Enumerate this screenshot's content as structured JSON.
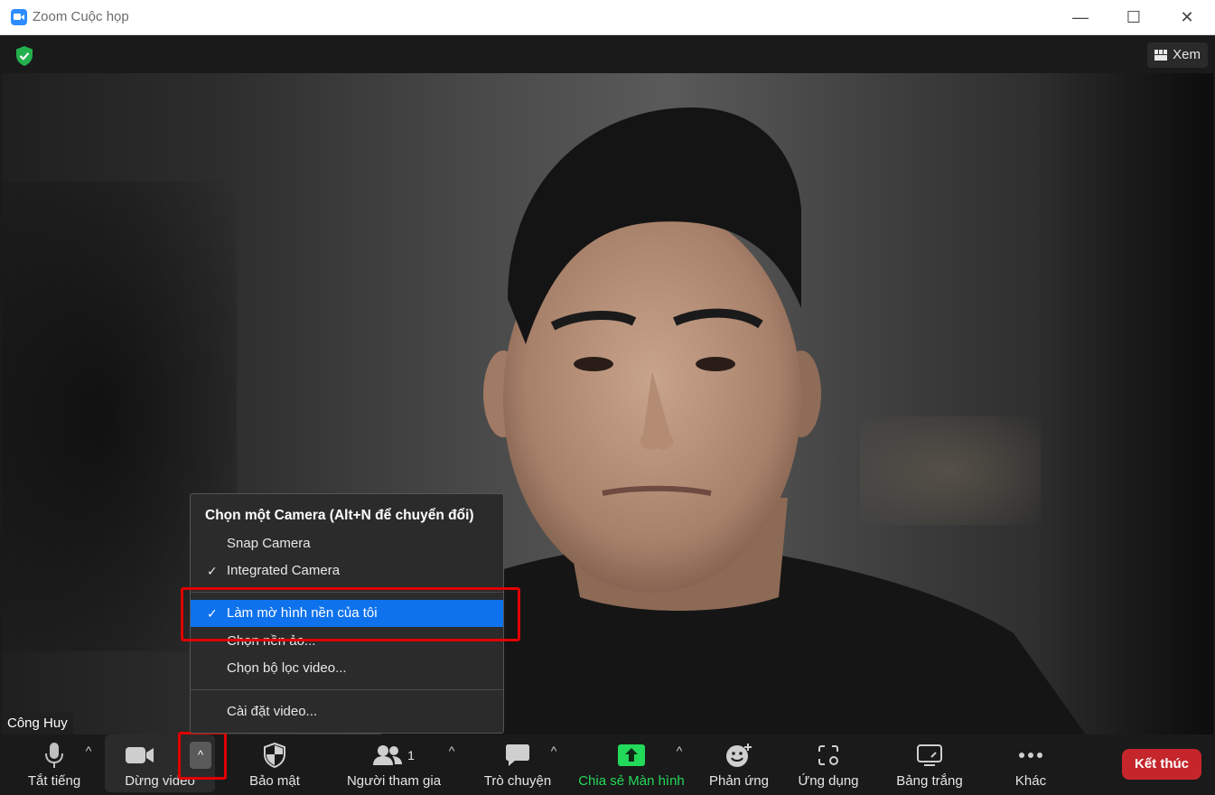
{
  "window": {
    "title": "Zoom Cuộc họp",
    "minimize": "—",
    "maximize": "☐",
    "close": "✕"
  },
  "top": {
    "view_label": "Xem"
  },
  "video": {
    "participant_name": "Công Huy"
  },
  "toolbar": {
    "mute_label": "Tắt tiếng",
    "video_label": "Dừng video",
    "security_label": "Bảo mật",
    "participants_label": "Người tham gia",
    "participants_count": "1",
    "chat_label": "Trò chuyện",
    "share_label": "Chia sẻ Màn hình",
    "reactions_label": "Phản ứng",
    "apps_label": "Ứng dụng",
    "whiteboard_label": "Bảng trắng",
    "more_label": "Khác",
    "end_label": "Kết thúc",
    "caret": "^",
    "share_color": "#23d959",
    "end_color": "#c4262b"
  },
  "camera_menu": {
    "header": "Chọn một Camera (Alt+N để chuyển đổi)",
    "items": [
      {
        "label": "Snap Camera",
        "checked": false
      },
      {
        "label": "Integrated Camera",
        "checked": true
      }
    ],
    "blur_item": {
      "label": "Làm mờ hình nền của tôi",
      "checked": true
    },
    "virtual_bg": "Chọn nền ảo...",
    "video_filter": "Chọn bộ lọc video...",
    "video_settings": "Cài đặt video...",
    "check_glyph": "✓",
    "highlight_color": "#0e72ed"
  }
}
